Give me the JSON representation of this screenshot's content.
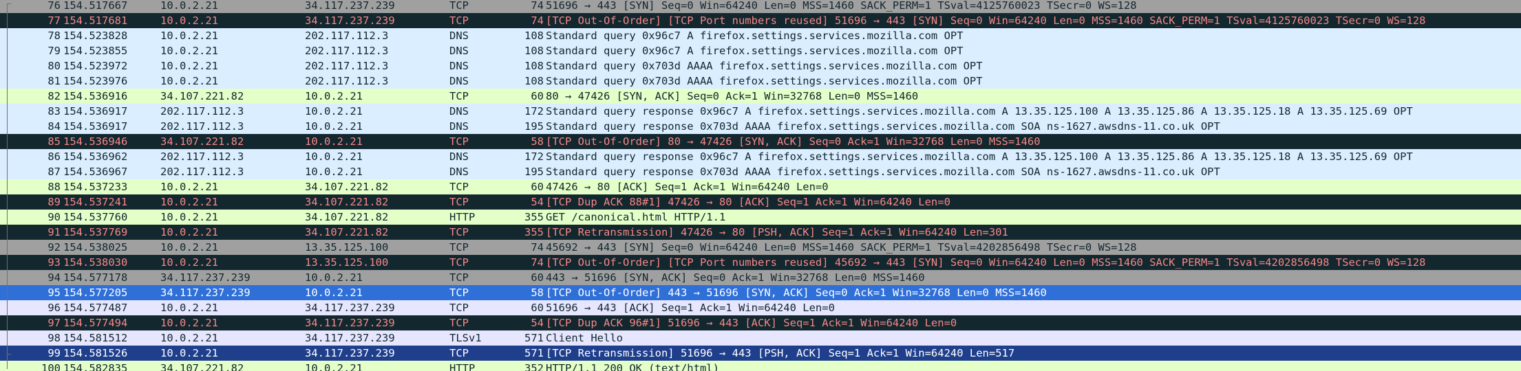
{
  "colors": {
    "tcp_handshake": "#a0a0a0",
    "tcp_error": "#12272e",
    "tcp_error_text": "#f78787",
    "dns": "#daeeff",
    "tcp": "#e7e6ff",
    "http_tcp": "#e4ffc7",
    "selected": "#2f6fd8",
    "selected_alt": "#1f3f8c",
    "text": "#12272e"
  },
  "packets": [
    {
      "no": "76",
      "time": "154.517667",
      "src": "10.0.2.21",
      "dst": "34.117.237.239",
      "proto": "TCP",
      "len": "74",
      "info": "51696 → 443 [SYN] Seq=0 Win=64240 Len=0 MSS=1460 SACK_PERM=1 TSval=4125760023 TSecr=0 WS=128",
      "style": "gray"
    },
    {
      "no": "77",
      "time": "154.517681",
      "src": "10.0.2.21",
      "dst": "34.117.237.239",
      "proto": "TCP",
      "len": "74",
      "info": "[TCP Out-Of-Order] [TCP Port numbers reused] 51696 → 443 [SYN] Seq=0 Win=64240 Len=0 MSS=1460 SACK_PERM=1 TSval=4125760023 TSecr=0 WS=128",
      "style": "err"
    },
    {
      "no": "78",
      "time": "154.523828",
      "src": "10.0.2.21",
      "dst": "202.117.112.3",
      "proto": "DNS",
      "len": "108",
      "info": "Standard query 0x96c7 A firefox.settings.services.mozilla.com OPT",
      "style": "dns"
    },
    {
      "no": "79",
      "time": "154.523855",
      "src": "10.0.2.21",
      "dst": "202.117.112.3",
      "proto": "DNS",
      "len": "108",
      "info": "Standard query 0x96c7 A firefox.settings.services.mozilla.com OPT",
      "style": "dns"
    },
    {
      "no": "80",
      "time": "154.523972",
      "src": "10.0.2.21",
      "dst": "202.117.112.3",
      "proto": "DNS",
      "len": "108",
      "info": "Standard query 0x703d AAAA firefox.settings.services.mozilla.com OPT",
      "style": "dns"
    },
    {
      "no": "81",
      "time": "154.523976",
      "src": "10.0.2.21",
      "dst": "202.117.112.3",
      "proto": "DNS",
      "len": "108",
      "info": "Standard query 0x703d AAAA firefox.settings.services.mozilla.com OPT",
      "style": "dns"
    },
    {
      "no": "82",
      "time": "154.536916",
      "src": "34.107.221.82",
      "dst": "10.0.2.21",
      "proto": "TCP",
      "len": "60",
      "info": "80 → 47426 [SYN, ACK] Seq=0 Ack=1 Win=32768 Len=0 MSS=1460",
      "style": "green"
    },
    {
      "no": "83",
      "time": "154.536917",
      "src": "202.117.112.3",
      "dst": "10.0.2.21",
      "proto": "DNS",
      "len": "172",
      "info": "Standard query response 0x96c7 A firefox.settings.services.mozilla.com A 13.35.125.100 A 13.35.125.86 A 13.35.125.18 A 13.35.125.69 OPT",
      "style": "dns"
    },
    {
      "no": "84",
      "time": "154.536917",
      "src": "202.117.112.3",
      "dst": "10.0.2.21",
      "proto": "DNS",
      "len": "195",
      "info": "Standard query response 0x703d AAAA firefox.settings.services.mozilla.com SOA ns-1627.awsdns-11.co.uk OPT",
      "style": "dns"
    },
    {
      "no": "85",
      "time": "154.536946",
      "src": "34.107.221.82",
      "dst": "10.0.2.21",
      "proto": "TCP",
      "len": "58",
      "info": "[TCP Out-Of-Order] 80 → 47426 [SYN, ACK] Seq=0 Ack=1 Win=32768 Len=0 MSS=1460",
      "style": "err"
    },
    {
      "no": "86",
      "time": "154.536962",
      "src": "202.117.112.3",
      "dst": "10.0.2.21",
      "proto": "DNS",
      "len": "172",
      "info": "Standard query response 0x96c7 A firefox.settings.services.mozilla.com A 13.35.125.100 A 13.35.125.86 A 13.35.125.18 A 13.35.125.69 OPT",
      "style": "dns"
    },
    {
      "no": "87",
      "time": "154.536967",
      "src": "202.117.112.3",
      "dst": "10.0.2.21",
      "proto": "DNS",
      "len": "195",
      "info": "Standard query response 0x703d AAAA firefox.settings.services.mozilla.com SOA ns-1627.awsdns-11.co.uk OPT",
      "style": "dns"
    },
    {
      "no": "88",
      "time": "154.537233",
      "src": "10.0.2.21",
      "dst": "34.107.221.82",
      "proto": "TCP",
      "len": "60",
      "info": "47426 → 80 [ACK] Seq=1 Ack=1 Win=64240 Len=0",
      "style": "green"
    },
    {
      "no": "89",
      "time": "154.537241",
      "src": "10.0.2.21",
      "dst": "34.107.221.82",
      "proto": "TCP",
      "len": "54",
      "info": "[TCP Dup ACK 88#1] 47426 → 80 [ACK] Seq=1 Ack=1 Win=64240 Len=0",
      "style": "err"
    },
    {
      "no": "90",
      "time": "154.537760",
      "src": "10.0.2.21",
      "dst": "34.107.221.82",
      "proto": "HTTP",
      "len": "355",
      "info": "GET /canonical.html HTTP/1.1",
      "style": "green"
    },
    {
      "no": "91",
      "time": "154.537769",
      "src": "10.0.2.21",
      "dst": "34.107.221.82",
      "proto": "TCP",
      "len": "355",
      "info": "[TCP Retransmission] 47426 → 80 [PSH, ACK] Seq=1 Ack=1 Win=64240 Len=301",
      "style": "err"
    },
    {
      "no": "92",
      "time": "154.538025",
      "src": "10.0.2.21",
      "dst": "13.35.125.100",
      "proto": "TCP",
      "len": "74",
      "info": "45692 → 443 [SYN] Seq=0 Win=64240 Len=0 MSS=1460 SACK_PERM=1 TSval=4202856498 TSecr=0 WS=128",
      "style": "gray"
    },
    {
      "no": "93",
      "time": "154.538030",
      "src": "10.0.2.21",
      "dst": "13.35.125.100",
      "proto": "TCP",
      "len": "74",
      "info": "[TCP Out-Of-Order] [TCP Port numbers reused] 45692 → 443 [SYN] Seq=0 Win=64240 Len=0 MSS=1460 SACK_PERM=1 TSval=4202856498 TSecr=0 WS=128",
      "style": "err"
    },
    {
      "no": "94",
      "time": "154.577178",
      "src": "34.117.237.239",
      "dst": "10.0.2.21",
      "proto": "TCP",
      "len": "60",
      "info": "443 → 51696 [SYN, ACK] Seq=0 Ack=1 Win=32768 Len=0 MSS=1460",
      "style": "gray"
    },
    {
      "no": "95",
      "time": "154.577205",
      "src": "34.117.237.239",
      "dst": "10.0.2.21",
      "proto": "TCP",
      "len": "58",
      "info": "[TCP Out-Of-Order] 443 → 51696 [SYN, ACK] Seq=0 Ack=1 Win=32768 Len=0 MSS=1460",
      "style": "sel"
    },
    {
      "no": "96",
      "time": "154.577487",
      "src": "10.0.2.21",
      "dst": "34.117.237.239",
      "proto": "TCP",
      "len": "60",
      "info": "51696 → 443 [ACK] Seq=1 Ack=1 Win=64240 Len=0",
      "style": "purple"
    },
    {
      "no": "97",
      "time": "154.577494",
      "src": "10.0.2.21",
      "dst": "34.117.237.239",
      "proto": "TCP",
      "len": "54",
      "info": "[TCP Dup ACK 96#1] 51696 → 443 [ACK] Seq=1 Ack=1 Win=64240 Len=0",
      "style": "err"
    },
    {
      "no": "98",
      "time": "154.581512",
      "src": "10.0.2.21",
      "dst": "34.117.237.239",
      "proto": "TLSv1",
      "len": "571",
      "info": "Client Hello",
      "style": "purple"
    },
    {
      "no": "99",
      "time": "154.581526",
      "src": "10.0.2.21",
      "dst": "34.117.237.239",
      "proto": "TCP",
      "len": "571",
      "info": "[TCP Retransmission] 51696 → 443 [PSH, ACK] Seq=1 Ack=1 Win=64240 Len=517",
      "style": "sel2"
    },
    {
      "no": "100",
      "time": "154.582835",
      "src": "34.107.221.82",
      "dst": "10.0.2.21",
      "proto": "HTTP",
      "len": "352",
      "info": "HTTP/1.1 200 OK  (text/html)",
      "style": "green"
    }
  ]
}
